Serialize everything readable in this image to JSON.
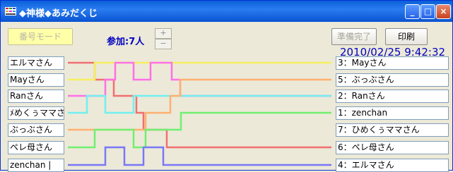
{
  "window": {
    "title": "◆神様◆あみだくじ",
    "icon": "app-grid-icon"
  },
  "toolbar": {
    "number_mode_label": "番号モード",
    "count_label": "参加:7人",
    "plus_label": "+",
    "minus_label": "−",
    "ready_label": "準備完了",
    "print_label": "印刷"
  },
  "datetime": "2010/02/25 9:42:32",
  "names": [
    "エルマさん",
    "Mayさん",
    "Ranさん",
    "ﾒめくぅママさん",
    "ぶっぶさん",
    "ペレ母さん",
    "zenchan |"
  ],
  "results": [
    "3：Mayさん",
    "5：ぶっぶさん",
    "2：Ranさん",
    "1：zenchan",
    "7：ひめくぅママさん",
    "6：ペレ母さん",
    "4：エルマさん"
  ],
  "colors": [
    "#f07070",
    "#f6f060",
    "#ff70e8",
    "#70f0f0",
    "#ffb070",
    "#70f070",
    "#7878f8"
  ]
}
